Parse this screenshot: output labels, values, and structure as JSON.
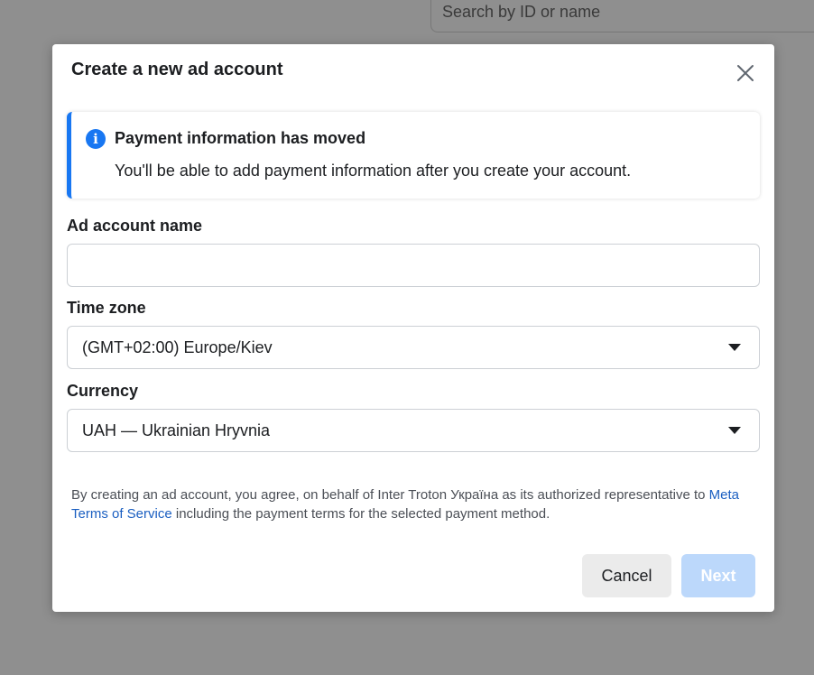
{
  "background": {
    "search_placeholder": "Search by ID or name"
  },
  "modal": {
    "title": "Create a new ad account",
    "close_icon": "close-icon",
    "info": {
      "icon": "info-icon",
      "icon_glyph": "i",
      "title": "Payment information has moved",
      "text": "You'll be able to add payment information after you create your account."
    },
    "fields": {
      "ad_account_name": {
        "label": "Ad account name",
        "value": ""
      },
      "time_zone": {
        "label": "Time zone",
        "value": "(GMT+02:00) Europe/Kiev"
      },
      "currency": {
        "label": "Currency",
        "value": "UAH — Ukrainian Hryvnia"
      }
    },
    "terms": {
      "prefix": "By creating an ad account, you agree, on behalf of Inter Troton Україна as its authorized representative to ",
      "link": "Meta Terms of Service",
      "suffix": " including the payment terms for the selected payment method."
    },
    "buttons": {
      "cancel": "Cancel",
      "next": "Next"
    }
  },
  "colors": {
    "accent": "#1877f2",
    "link": "#1b5fc1",
    "next_disabled": "#bcd8fb",
    "overlay": "#8f8f8f"
  }
}
